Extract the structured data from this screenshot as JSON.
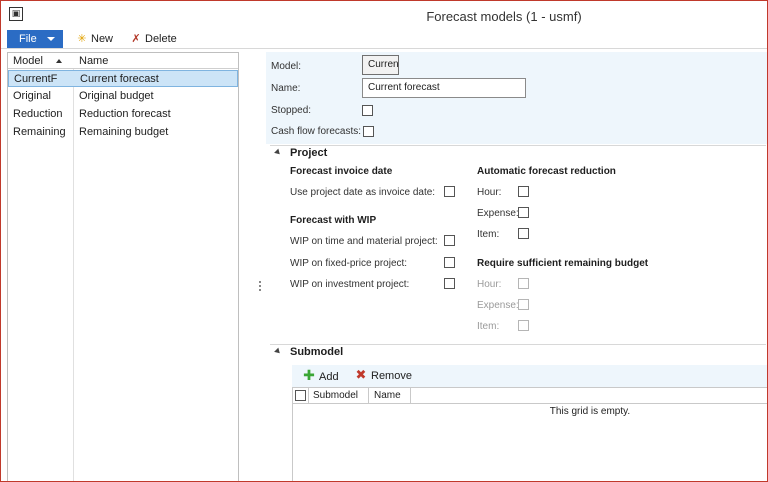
{
  "window": {
    "title": "Forecast models (1 - usmf)",
    "icon": "app-window-icon"
  },
  "ribbon": {
    "file_label": "File",
    "new_label": "New",
    "delete_label": "Delete"
  },
  "list": {
    "columns": {
      "model": "Model",
      "name": "Name"
    },
    "rows": [
      {
        "model": "CurrentF",
        "name": "Current forecast",
        "selected": true
      },
      {
        "model": "Original",
        "name": "Original budget",
        "selected": false
      },
      {
        "model": "Reduction",
        "name": "Reduction forecast",
        "selected": false
      },
      {
        "model": "Remaining",
        "name": "Remaining budget",
        "selected": false
      }
    ]
  },
  "details": {
    "model_label": "Model:",
    "model_value": "Curren",
    "name_label": "Name:",
    "name_value": "Current forecast",
    "stopped_label": "Stopped:",
    "cashflow_label": "Cash flow forecasts:"
  },
  "project": {
    "title": "Project",
    "invoice_date_group": "Forecast invoice date",
    "use_project_date": "Use project date as invoice date:",
    "wip_group": "Forecast with WIP",
    "wip_time_material": "WIP on time and material project:",
    "wip_fixed_price": "WIP on fixed-price project:",
    "wip_investment": "WIP on investment project:",
    "auto_reduction_group": "Automatic forecast reduction",
    "auto_hour": "Hour:",
    "auto_expense": "Expense:",
    "auto_item": "Item:",
    "require_budget_group": "Require sufficient remaining budget",
    "req_hour": "Hour:",
    "req_expense": "Expense:",
    "req_item": "Item:"
  },
  "submodel": {
    "title": "Submodel",
    "add_label": "Add",
    "remove_label": "Remove",
    "columns": {
      "submodel": "Submodel",
      "name": "Name"
    },
    "empty_text": "This grid is empty."
  },
  "colors": {
    "accent": "#2b6cc4",
    "selection": "#cce4f7",
    "panel_bg": "#eef6fc",
    "window_border": "#c0392b"
  }
}
